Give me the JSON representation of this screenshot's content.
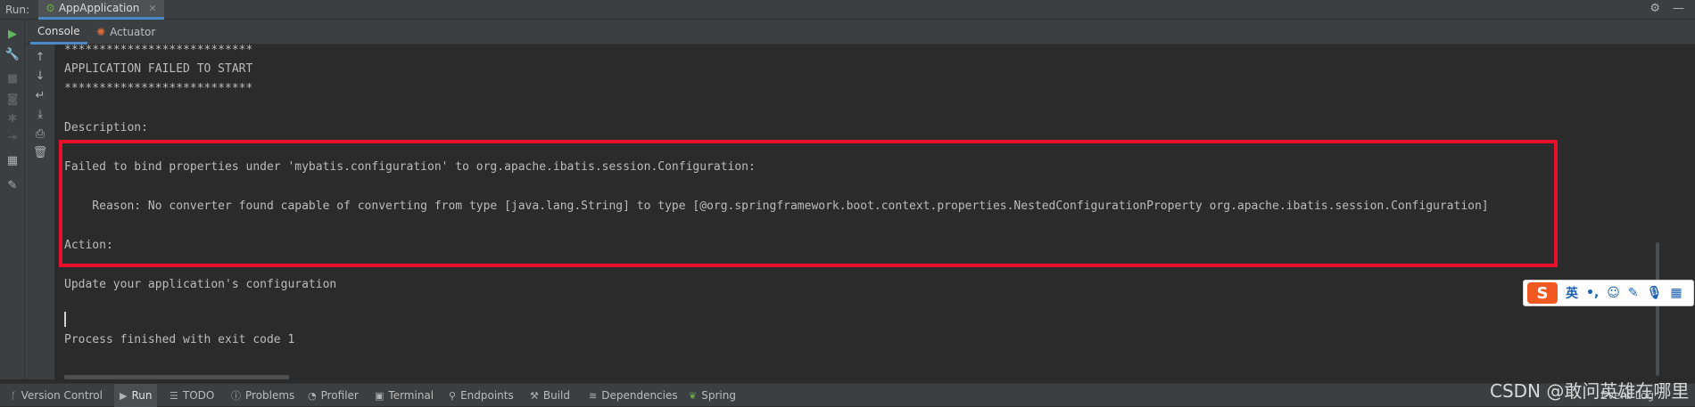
{
  "run_header": {
    "label": "Run:",
    "tab_title": "AppApplication",
    "close": "✕"
  },
  "sub_tabs": [
    {
      "label": "Console",
      "active": true
    },
    {
      "label": "Actuator",
      "active": false
    }
  ],
  "console_lines": [
    "***************************",
    "APPLICATION FAILED TO START",
    "***************************",
    "",
    "Description:",
    "",
    "Failed to bind properties under 'mybatis.configuration' to org.apache.ibatis.session.Configuration:",
    "",
    "    Reason: No converter found capable of converting from type [java.lang.String] to type [@org.springframework.boot.context.properties.NestedConfigurationProperty org.apache.ibatis.session.Configuration]",
    "",
    "Action:",
    "",
    "Update your application's configuration",
    "",
    "",
    "",
    "Process finished with exit code 1"
  ],
  "ime": {
    "logo": "S",
    "lang": "英",
    "punct": "•,",
    "emoji": "☺",
    "pen": "✎",
    "mic": "🎙",
    "grid": "▦"
  },
  "status_bar": {
    "items": [
      {
        "label": "Version Control",
        "icon": "branch-icon",
        "glyph": "ᚴ"
      },
      {
        "label": "Run",
        "icon": "run-icon",
        "glyph": "▶"
      },
      {
        "label": "TODO",
        "icon": "list-icon",
        "glyph": "☰"
      },
      {
        "label": "Problems",
        "icon": "info-icon",
        "glyph": "ⓘ"
      },
      {
        "label": "Profiler",
        "icon": "profiler-icon",
        "glyph": "◔"
      },
      {
        "label": "Terminal",
        "icon": "terminal-icon",
        "glyph": "▣"
      },
      {
        "label": "Endpoints",
        "icon": "endpoints-icon",
        "glyph": "⚲"
      },
      {
        "label": "Build",
        "icon": "hammer-icon",
        "glyph": "⚒"
      },
      {
        "label": "Dependencies",
        "icon": "layers-icon",
        "glyph": "≋"
      },
      {
        "label": "Spring",
        "icon": "leaf-icon",
        "glyph": "❦"
      }
    ],
    "event_log": "Event Log"
  },
  "watermark": "CSDN @敢问英雄在哪里",
  "colors": {
    "highlight_border": "#e8102d",
    "accent": "#4a88c7",
    "console_bg": "#2b2b2b",
    "panel_bg": "#3c3f41"
  }
}
